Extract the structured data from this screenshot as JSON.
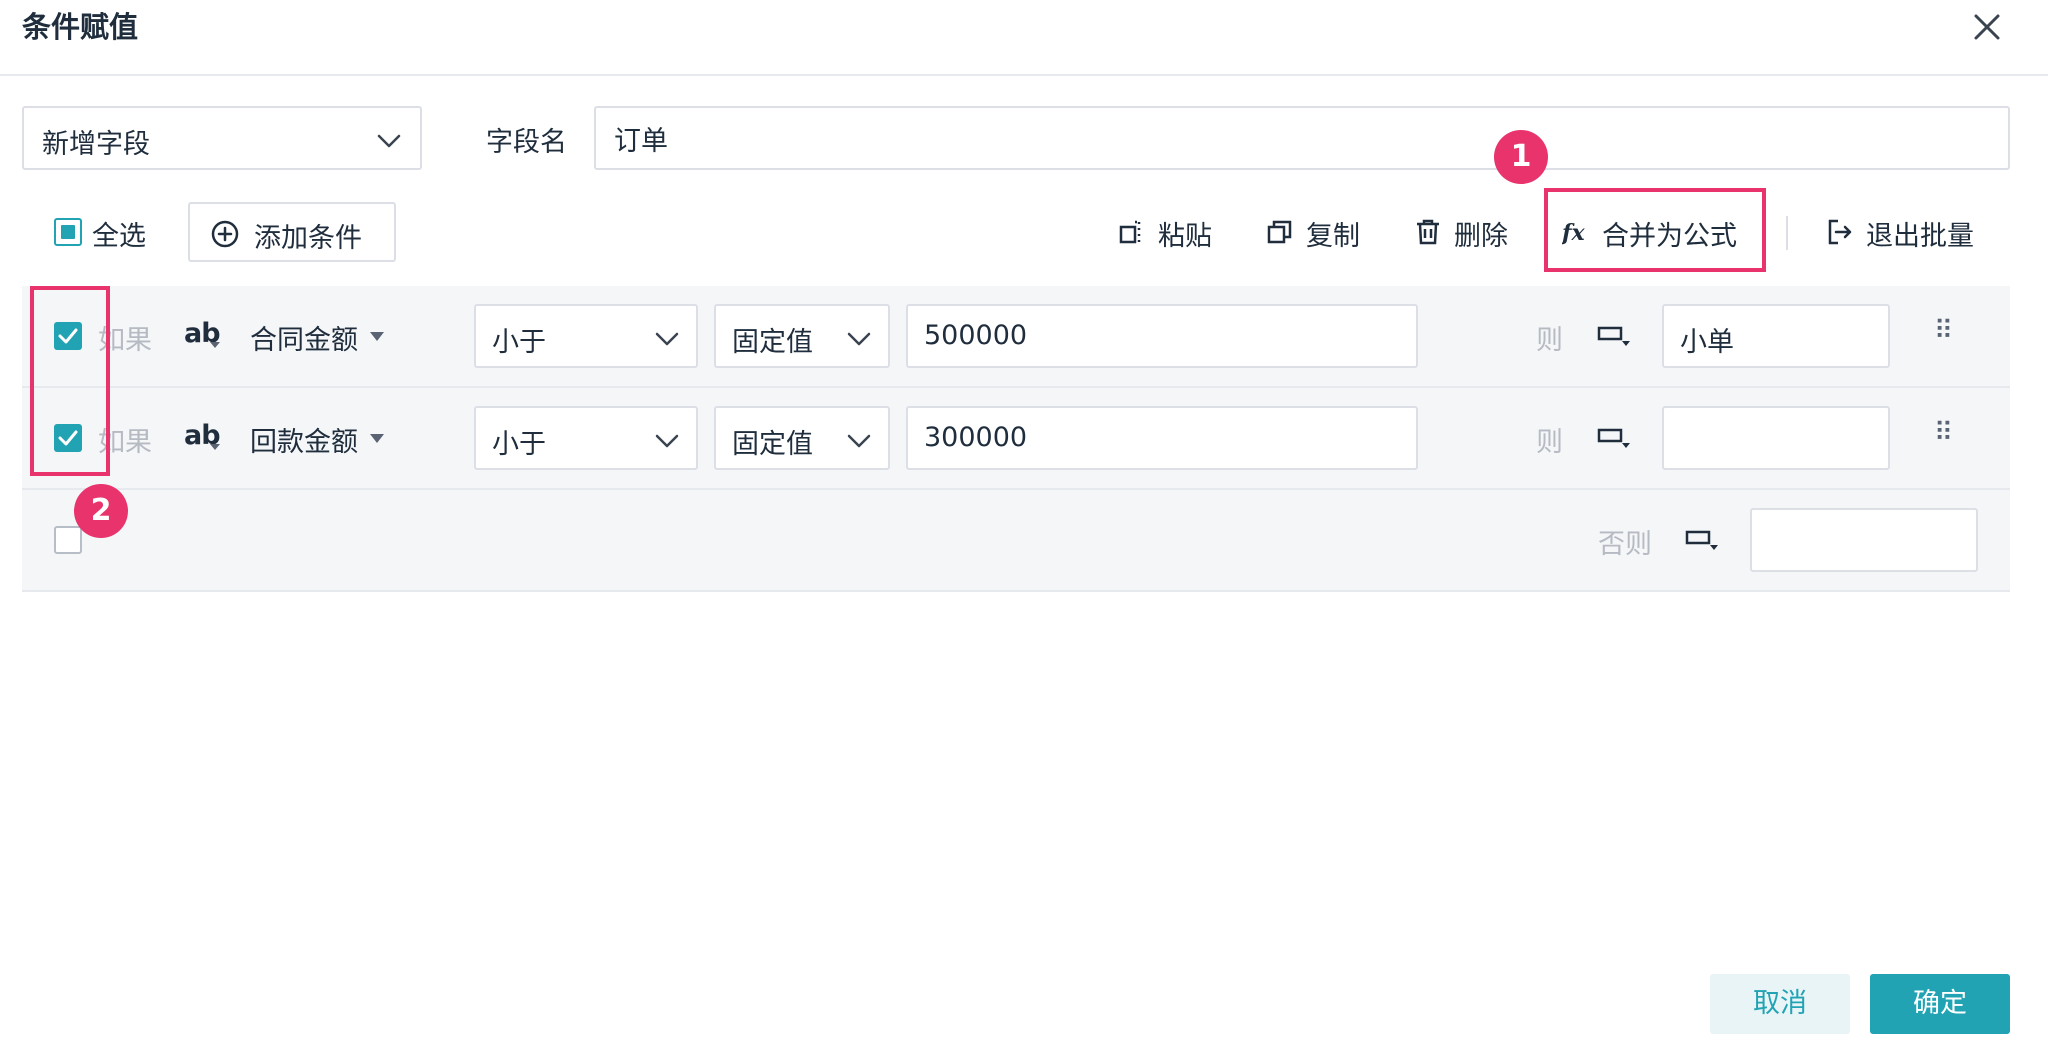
{
  "dialog": {
    "title": "条件赋值"
  },
  "field_row": {
    "select_value": "新增字段",
    "name_label": "字段名",
    "name_value": "订单"
  },
  "toolbar": {
    "select_all": "全选",
    "add_condition": "添加条件",
    "paste": "粘贴",
    "copy": "复制",
    "delete": "删除",
    "merge_formula": "合并为公式",
    "exit_batch": "退出批量"
  },
  "annotations": {
    "badge1": "1",
    "badge2": "2"
  },
  "conditions": [
    {
      "checked": true,
      "if_label": "如果",
      "type_icon": "ab",
      "field": "合同金额",
      "operator": "小于",
      "value_type": "固定值",
      "value": "500000",
      "then_label": "则",
      "result": "小单"
    },
    {
      "checked": true,
      "if_label": "如果",
      "type_icon": "ab",
      "field": "回款金额",
      "operator": "小于",
      "value_type": "固定值",
      "value": "300000",
      "then_label": "则",
      "result": ""
    }
  ],
  "else_row": {
    "checked": false,
    "label": "否则",
    "result": ""
  },
  "footer": {
    "cancel": "取消",
    "confirm": "确定"
  },
  "colors": {
    "accent": "#21a3b4",
    "annotation": "#e8336d",
    "text": "#1f2d3d",
    "muted": "#b5bac3"
  }
}
